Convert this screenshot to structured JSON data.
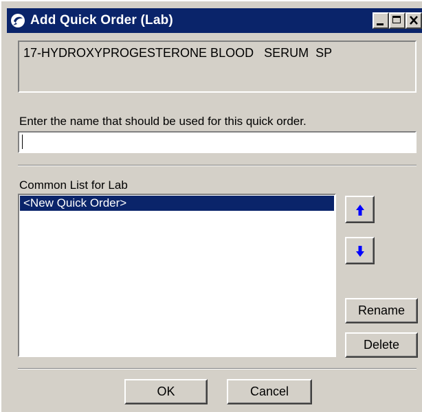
{
  "window": {
    "title": "Add Quick Order (Lab)"
  },
  "order": {
    "description": "17-HYDROXYPROGESTERONE BLOOD   SERUM  SP"
  },
  "name_prompt": {
    "label": "Enter the name that should be used for this quick order.",
    "value": ""
  },
  "common_list": {
    "label": "Common List for Lab",
    "items": [
      "<New Quick Order>"
    ],
    "selected_index": 0
  },
  "buttons": {
    "move_up_icon": "arrow-up-icon",
    "move_down_icon": "arrow-down-icon",
    "rename": "Rename",
    "delete": "Delete",
    "ok": "OK",
    "cancel": "Cancel"
  },
  "colors": {
    "titlebar": "#0a246a",
    "selection": "#0a246a",
    "arrow": "#0000ff",
    "face": "#d4d0c8"
  }
}
